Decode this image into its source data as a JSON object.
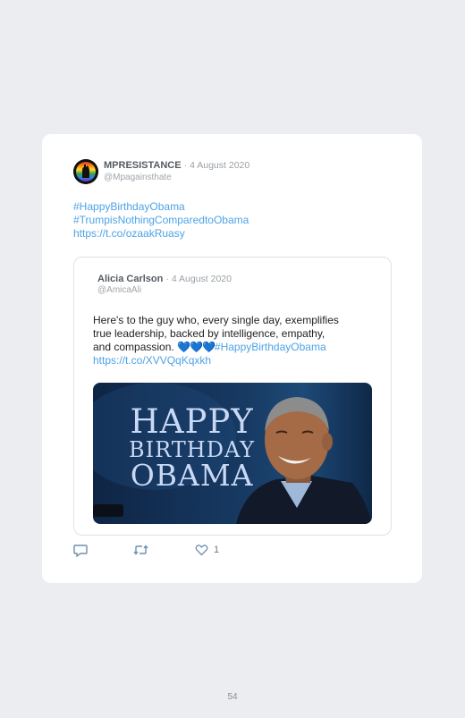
{
  "tweet": {
    "author_name": "MPRESISTANCE",
    "date": "· 4 August 2020",
    "handle": "@Mpagainsthate",
    "lines": [
      "#HappyBirthdayObama",
      "#TrumpisNothingComparedtoObama",
      "https://t.co/ozaakRuasy"
    ]
  },
  "quoted": {
    "author_name": "Alicia Carlson",
    "date": "· 4 August 2020",
    "handle": "@AmicaAli",
    "text_line1": "Here's to the guy who, every single day, exemplifies",
    "text_line2": "true leadership, backed by intelligence, empathy,",
    "text_line3_plain": "and compassion. ",
    "hearts": "💙💙💙",
    "hashtag": "#HappyBirthdayObama",
    "link": "https://t.co/XVVQqKqxkh",
    "image": {
      "line1": "HAPPY",
      "line2": "BIRTHDAY",
      "line3": "OBAMA"
    }
  },
  "actions": {
    "like_count": "1",
    "reply_icon": "reply-icon",
    "retweet_icon": "retweet-icon",
    "like_icon": "heart-icon"
  },
  "page_number": "54",
  "colors": {
    "link": "#4da3e6",
    "background": "#ebedf0"
  }
}
